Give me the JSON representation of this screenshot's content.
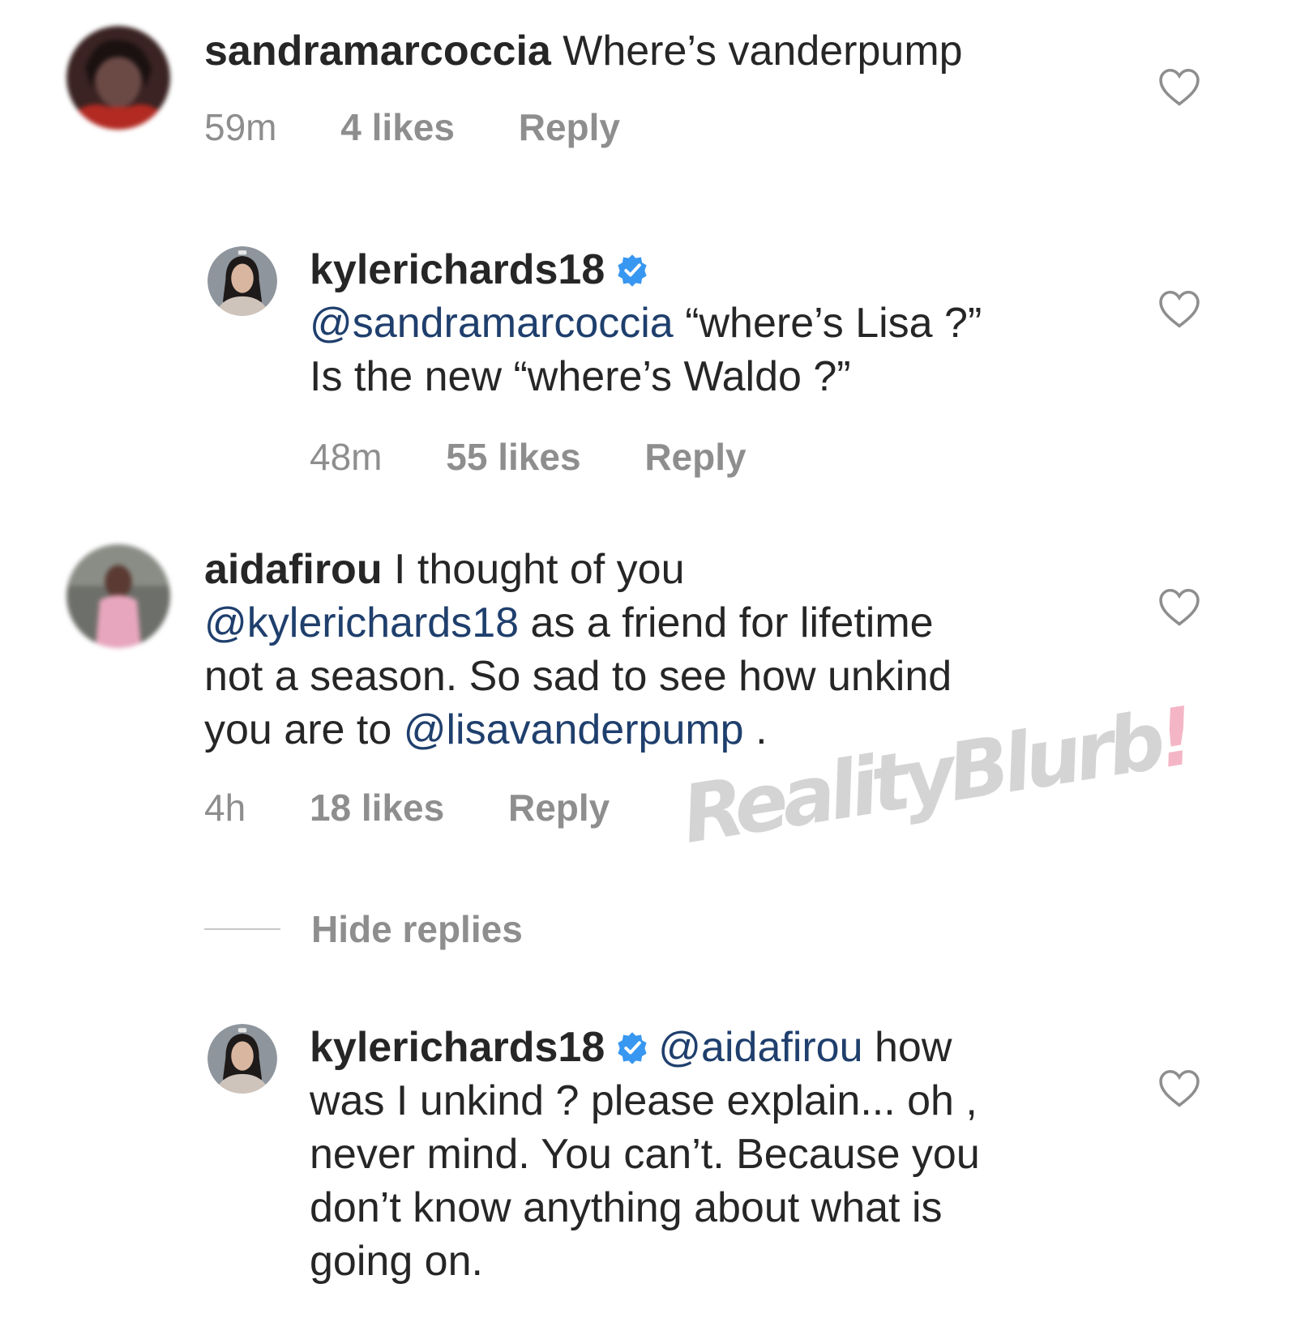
{
  "colors": {
    "text": "#262626",
    "secondary": "#8e8e8e",
    "mention": "#1f3f6d",
    "verified": "#3897f0",
    "watermark": "#d4d4d4",
    "watermark_accent": "#f4b6c6"
  },
  "comments": [
    {
      "username": "sandramarcoccia",
      "text": "Where’s vanderpump",
      "time": "59m",
      "likes": "4 likes",
      "reply": "Reply",
      "icon": "heart-outline-icon"
    },
    {
      "username": "kylerichards18",
      "verified": true,
      "mention": "@sandramarcoccia",
      "text_1": "“where’s Lisa ?”",
      "text_2": "Is the new “where’s Waldo ?”",
      "time": "48m",
      "likes": "55 likes",
      "reply": "Reply",
      "icon": "heart-outline-icon"
    },
    {
      "username": "aidafirou",
      "text_1": "I thought of you",
      "mention_1": "@kylerichards18",
      "text_2": "as a friend for lifetime",
      "text_3": "not a season. So sad to see how unkind",
      "text_4": "you are to",
      "mention_2": "@lisavanderpump",
      "text_5": ".",
      "time": "4h",
      "likes": "18 likes",
      "reply": "Reply",
      "icon": "heart-outline-icon"
    },
    {
      "username": "kylerichards18",
      "verified": true,
      "mention": "@aidafirou",
      "text_1": "how",
      "text_2": "was I unkind ? please explain... oh ,",
      "text_3": "never mind. You can’t. Because you",
      "text_4": "don’t know anything about what is",
      "text_5": "going on.",
      "icon": "heart-outline-icon"
    }
  ],
  "hide_replies": "Hide replies",
  "watermark": {
    "text": "RealityBlurb",
    "accent": "!"
  }
}
